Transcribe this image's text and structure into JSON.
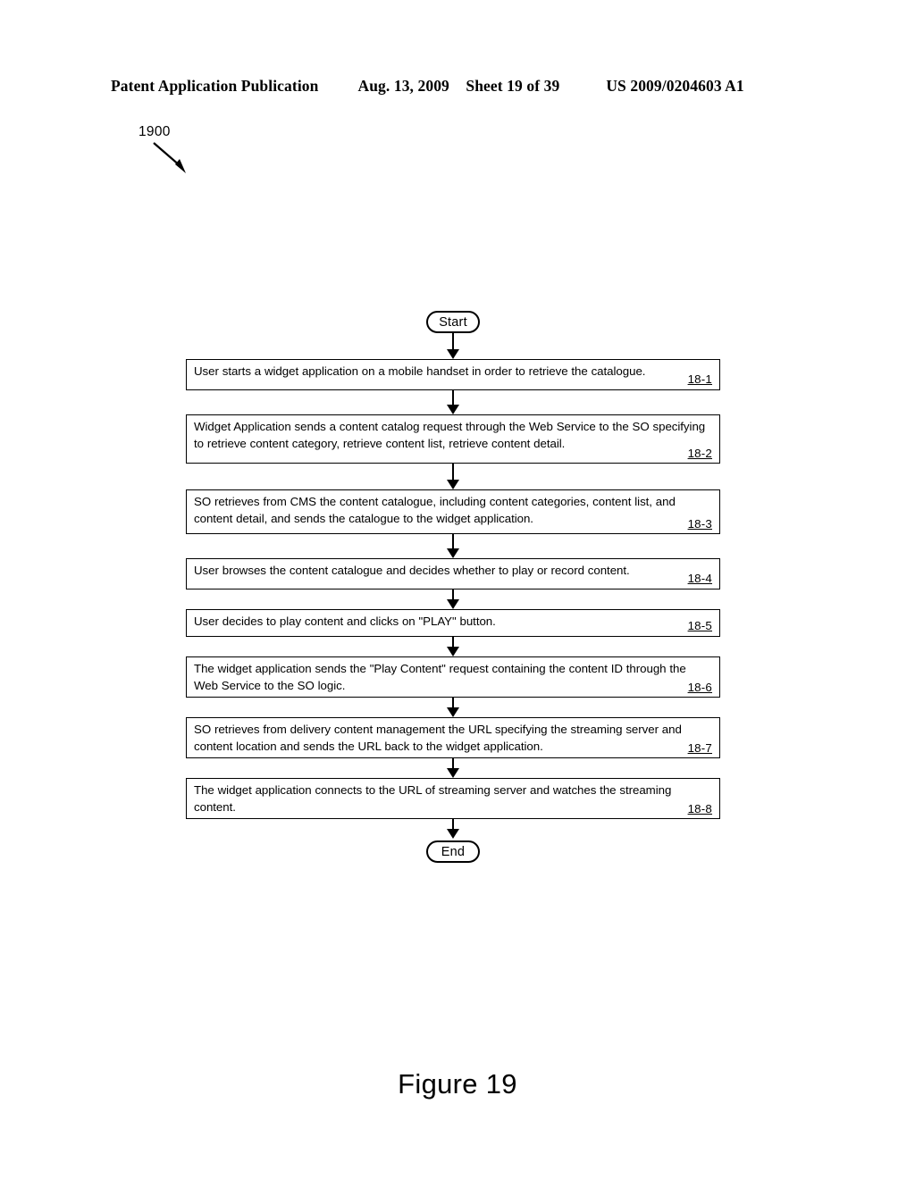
{
  "header": {
    "left": "Patent Application Publication",
    "date": "Aug. 13, 2009",
    "sheet": "Sheet 19 of 39",
    "pub_number": "US 2009/0204603 A1"
  },
  "figure": {
    "reference_numeral": "1900",
    "caption": "Figure 19"
  },
  "flowchart": {
    "start_label": "Start",
    "end_label": "End",
    "steps": [
      {
        "text": "User starts a widget application on a mobile handset in order to retrieve the catalogue.",
        "label": "18-1"
      },
      {
        "text": "Widget Application sends a content catalog request through the Web Service to the SO specifying to retrieve content category, retrieve content list, retrieve content detail.",
        "label": "18-2"
      },
      {
        "text": "SO retrieves from CMS the content catalogue, including content categories, content list, and content detail, and sends the catalogue to the widget application.",
        "label": "18-3"
      },
      {
        "text": "User browses the content catalogue and decides whether to play or record content.",
        "label": "18-4"
      },
      {
        "text": "User decides to play content and clicks on \"PLAY\" button.",
        "label": "18-5"
      },
      {
        "text": "The widget application sends the \"Play Content\" request containing the content ID through the Web Service to the SO logic.",
        "label": "18-6"
      },
      {
        "text": "SO retrieves from delivery content management the URL specifying the streaming server and content location and sends the URL back to the widget application.",
        "label": "18-7"
      },
      {
        "text": "The widget application connects to the URL of streaming server and watches the streaming content.",
        "label": "18-8"
      }
    ]
  }
}
